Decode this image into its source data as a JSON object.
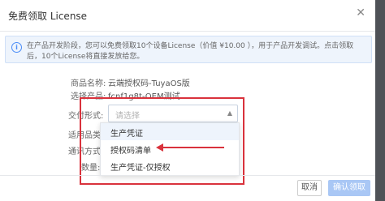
{
  "dialog": {
    "title": "免费领取 License",
    "close_icon": "close-icon",
    "notice": "在产品开发阶段，您可以免费领取10个设备License（价值 ¥10.00 ），用于产品开发调试。点击领取后，10个License将直接发放给您。",
    "fields": {
      "product_name_label": "商品名称:",
      "product_name_value": "云端授权码-TuyaOS版",
      "select_product_label": "选择产品:",
      "select_product_value": "fcnf1g8t-OEM测试",
      "delivery_label": "交付形式:",
      "delivery_placeholder": "请选择",
      "category_label": "适用品类:",
      "comm_label": "通讯方式:",
      "qty_label": "数量:"
    },
    "delivery_options": [
      "生产凭证",
      "授权码清单",
      "生产凭证-仅授权"
    ],
    "buttons": {
      "cancel": "取消",
      "confirm": "确认领取"
    }
  }
}
